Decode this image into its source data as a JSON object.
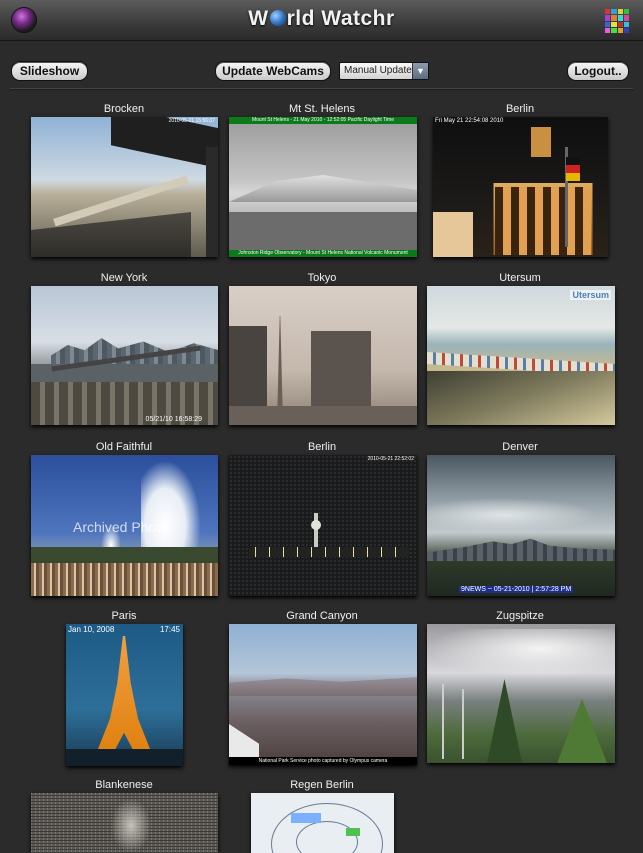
{
  "app": {
    "title_pre": "W",
    "title_post": "rld Watchr"
  },
  "toolbar": {
    "slideshow_label": "Slideshow",
    "update_label": "Update WebCams",
    "mode_select": "Manual Update",
    "logout_label": "Logout.."
  },
  "colors": {
    "background": "#2b2b2b",
    "grid_icon": [
      "#e03030",
      "#30a0e0",
      "#e0d030",
      "#30c040",
      "#a040e0",
      "#e08030",
      "#30e0d0",
      "#e040a0",
      "#4060e0",
      "#e0e040",
      "#c03030",
      "#30c0e0",
      "#e060e0",
      "#40e040",
      "#e0a030",
      "#3040c0"
    ]
  },
  "cams": [
    {
      "name": "Brocken",
      "overlay": "2010-05-21 15:56:07",
      "scene": "brocken"
    },
    {
      "name": "Mt St. Helens",
      "overlay_top": "Mount St Helens - 21 May 2010 - 12:52:05 Pacific Daylight Time",
      "overlay_bottom": "Johnston Ridge Observatory - Mount St Helens National Volcanic Monument",
      "scene": "helens"
    },
    {
      "name": "Berlin",
      "overlay": "Fri May 21 22:54:08 2010",
      "scene": "berlin1"
    },
    {
      "name": "New York",
      "overlay": "05/21/10 16:58:29",
      "scene": "newyork"
    },
    {
      "name": "Tokyo",
      "scene": "tokyo"
    },
    {
      "name": "Utersum",
      "overlay": "Utersum",
      "scene": "utersum"
    },
    {
      "name": "Old Faithful",
      "overlay": "Archived Photo",
      "scene": "faithful"
    },
    {
      "name": "Berlin",
      "overlay": "2010-05-21 22:52:02",
      "scene": "berlin2"
    },
    {
      "name": "Denver",
      "overlay": "9NEWS ~ 05-21-2010 | 2:57:28 PM",
      "scene": "denver"
    },
    {
      "name": "Paris",
      "overlay_left": "Jan 10, 2008",
      "overlay_right": "17:45",
      "scene": "paris"
    },
    {
      "name": "Grand Canyon",
      "overlay": "National Park Service photo captured by Olympus camera",
      "scene": "canyon"
    },
    {
      "name": "Zugspitze",
      "scene": "zugspitze"
    },
    {
      "name": "Blankenese",
      "scene": "blankenese"
    },
    {
      "name": "Regen Berlin",
      "scene": "regen"
    }
  ]
}
